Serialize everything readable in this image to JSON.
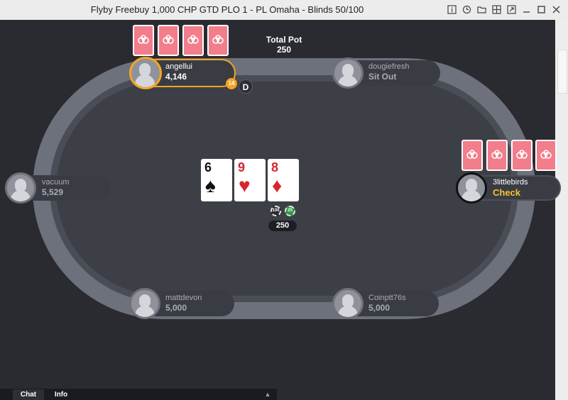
{
  "window": {
    "title": "Flyby Freebuy 1,000 CHP GTD PLO 1 - PL Omaha - Blinds 50/100"
  },
  "window_controls": [
    {
      "name": "info-icon"
    },
    {
      "name": "history-icon"
    },
    {
      "name": "folder-icon"
    },
    {
      "name": "tiles-icon"
    },
    {
      "name": "expand-icon"
    },
    {
      "name": "minimize-icon"
    },
    {
      "name": "maximize-icon"
    },
    {
      "name": "close-icon"
    }
  ],
  "pot": {
    "label": "Total Pot",
    "value": "250",
    "pill": "250",
    "chips": [
      "100",
      "25"
    ]
  },
  "dealer_button": "D",
  "action_timer": "14",
  "board": [
    {
      "rank": "6",
      "suit": "♠",
      "color": "#111111"
    },
    {
      "rank": "9",
      "suit": "♥",
      "color": "#d7262f"
    },
    {
      "rank": "8",
      "suit": "♦",
      "color": "#d7262f"
    }
  ],
  "players": {
    "angellui": {
      "name": "angellui",
      "stack": "4,146"
    },
    "dougiefresh": {
      "name": "dougiefresh",
      "stack": "Sit Out"
    },
    "vacuum": {
      "name": "vacuum",
      "stack": "5,529"
    },
    "hero": {
      "name": "3littlebirds",
      "stack": "Check"
    },
    "mattdevon": {
      "name": "mattdevon",
      "stack": "5,000"
    },
    "coinptt": {
      "name": "Coinptt76s",
      "stack": "5,000"
    }
  },
  "tabs": {
    "chat": "Chat",
    "info": "Info"
  },
  "colors": {
    "card_back": "#f27d8b",
    "active_turn": "#f4a423",
    "action_text": "#f4c431"
  }
}
